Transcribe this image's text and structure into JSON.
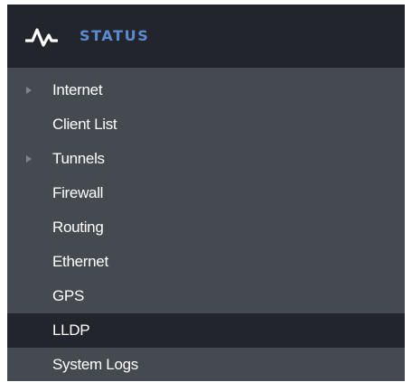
{
  "menu": {
    "header": {
      "icon": "activity-pulse-icon",
      "title": "STATUS"
    },
    "items": [
      {
        "label": "Internet",
        "expandable": true,
        "selected": false
      },
      {
        "label": "Client List",
        "expandable": false,
        "selected": false
      },
      {
        "label": "Tunnels",
        "expandable": true,
        "selected": false
      },
      {
        "label": "Firewall",
        "expandable": false,
        "selected": false
      },
      {
        "label": "Routing",
        "expandable": false,
        "selected": false
      },
      {
        "label": "Ethernet",
        "expandable": false,
        "selected": false
      },
      {
        "label": "GPS",
        "expandable": false,
        "selected": false
      },
      {
        "label": "LLDP",
        "expandable": false,
        "selected": true
      },
      {
        "label": "System Logs",
        "expandable": false,
        "selected": false
      }
    ]
  },
  "colors": {
    "header_bg": "#22262c",
    "menu_bg": "#454a50",
    "selected_bg": "#22262c",
    "accent": "#5b8bd0",
    "text": "#ffffff",
    "arrow": "#80868c"
  }
}
